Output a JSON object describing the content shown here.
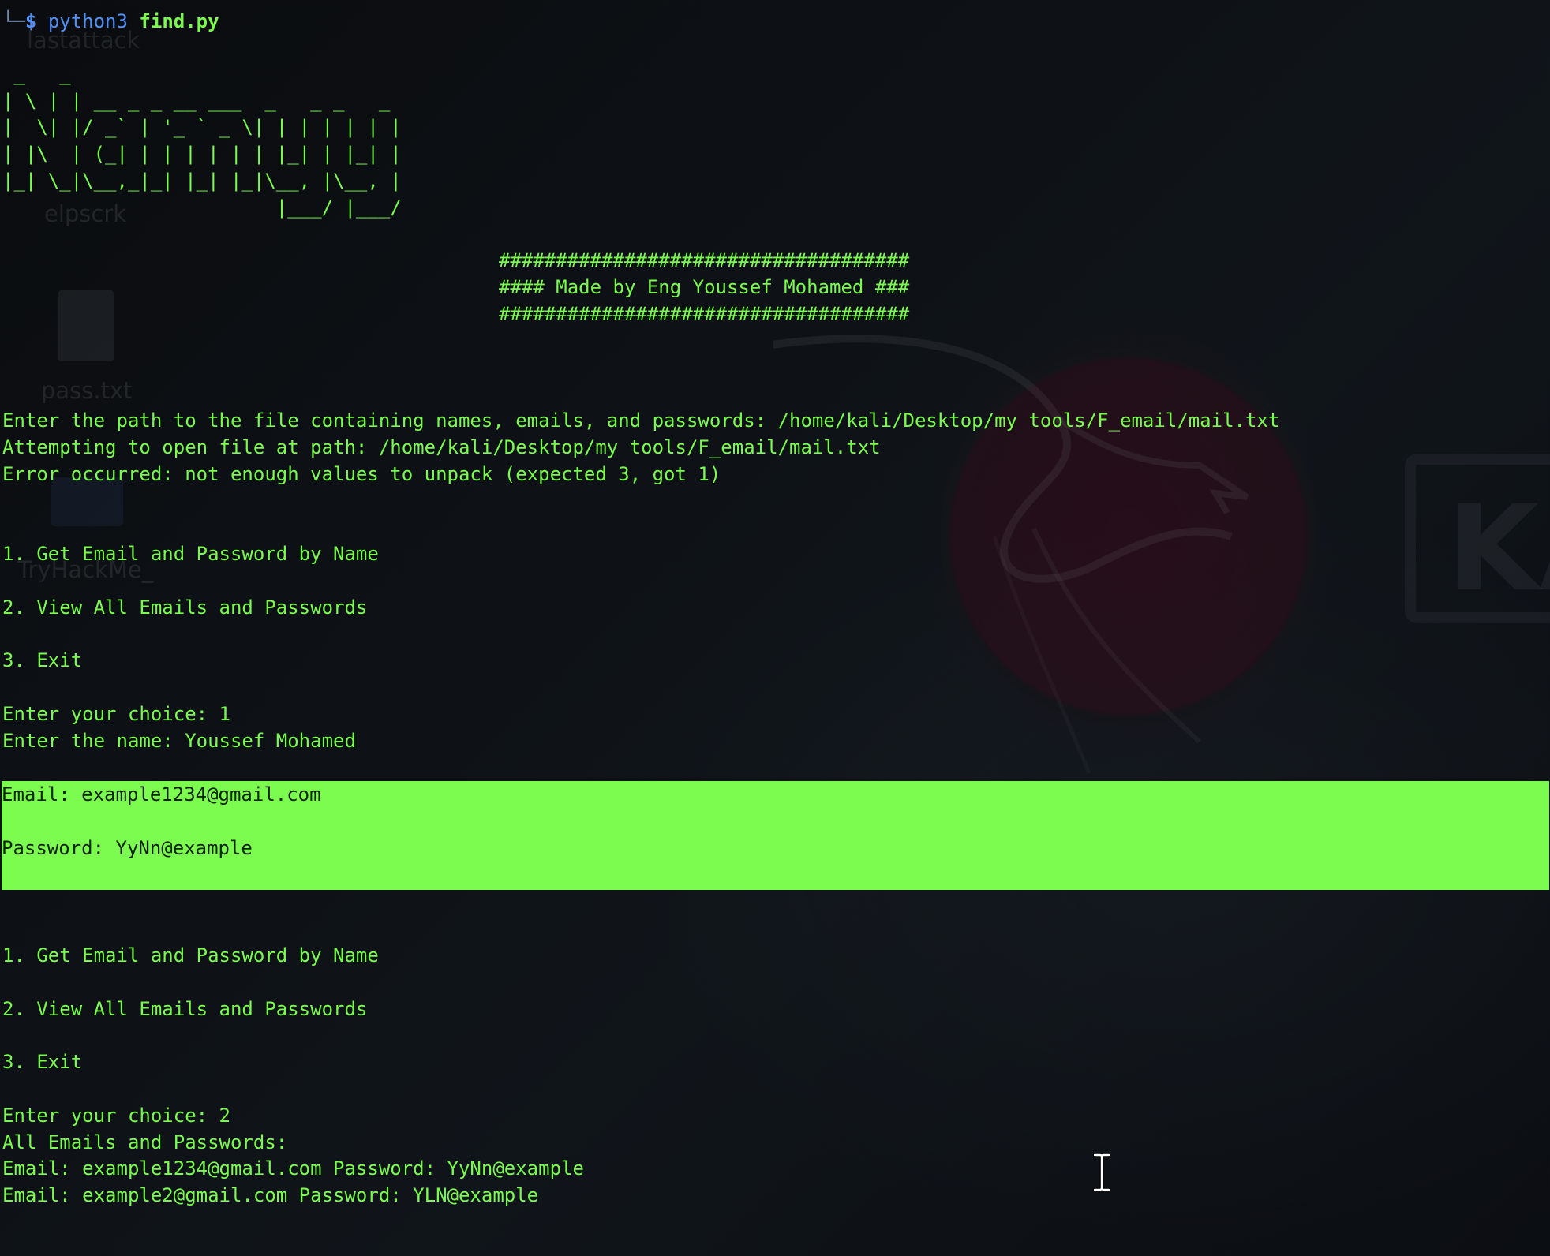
{
  "theme": {
    "background": "#0c0f12",
    "text_color": "#79fc4d",
    "highlight_bg": "#7bfc4e",
    "highlight_text": "#0a2207",
    "prompt_color": "#4f8ff7"
  },
  "desktop": {
    "icons": [
      {
        "label": "lastattack"
      },
      {
        "label": "elpscrk"
      },
      {
        "label": "pass.txt"
      },
      {
        "label": "TryHackMe_"
      }
    ],
    "wallpaper_text": "KA"
  },
  "prompt": {
    "corner": "└─",
    "symbol": "$",
    "command": "python3",
    "argument": "find.py"
  },
  "banner_ascii": [
    " _   _",
    "| \\ | | __ _ _ __ ___  _   _ _   _",
    "|  \\| |/ _` | '_ ` _ \\| | | | | | |",
    "| |\\  | (_| | | | | | | |_| | |_| |",
    "|_| \\_|\\__,_|_| |_| |_|\\__, |\\__, |",
    "                        |___/ |___/"
  ],
  "credit_block": [
    "####################################",
    "#### Made by Eng Youssef Mohamed ###",
    "####################################"
  ],
  "output_lines": {
    "enter_path": "Enter the path to the file containing names, emails, and passwords: /home/kali/Desktop/my tools/F_email/mail.txt",
    "attempting": "Attempting to open file at path: /home/kali/Desktop/my tools/F_email/mail.txt",
    "error": "Error occurred: not enough values to unpack (expected 3, got 1)"
  },
  "menu": {
    "option1": "1. Get Email and Password by Name",
    "option2": "2. View All Emails and Passwords",
    "option3": "3. Exit"
  },
  "session1": {
    "choice": "Enter your choice: 1",
    "name": "Enter the name: Youssef Mohamed",
    "result_email": "Email: example1234@gmail.com",
    "result_password": "Password: YyNn@example"
  },
  "session2": {
    "choice": "Enter your choice: 2",
    "header": "All Emails and Passwords:",
    "entries": [
      "Email: example1234@gmail.com Password: YyNn@example",
      "Email: example2@gmail.com Password: YLN@example"
    ]
  }
}
